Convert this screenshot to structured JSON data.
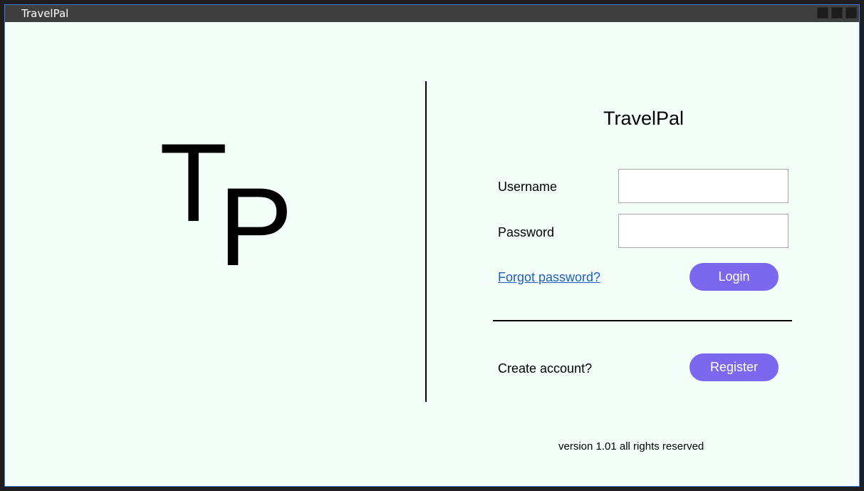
{
  "window": {
    "title": "TravelPal",
    "controls": [
      "minimize-icon",
      "maximize-icon",
      "close-icon"
    ]
  },
  "logo": {
    "letter_t": "T",
    "letter_p": "P"
  },
  "login": {
    "title": "TravelPal",
    "username_label": "Username",
    "username_value": "",
    "password_label": "Password",
    "password_value": "",
    "forgot_link": "Forgot password?",
    "login_button": "Login",
    "create_label": "Create account?",
    "register_button": "Register"
  },
  "footer": {
    "version_text": "version 1.01 all rights reserved"
  },
  "colors": {
    "background": "#f4fef9",
    "titlebar": "#3f3f3f",
    "accent_button": "#7b68ee",
    "link": "#1f5fbf"
  }
}
